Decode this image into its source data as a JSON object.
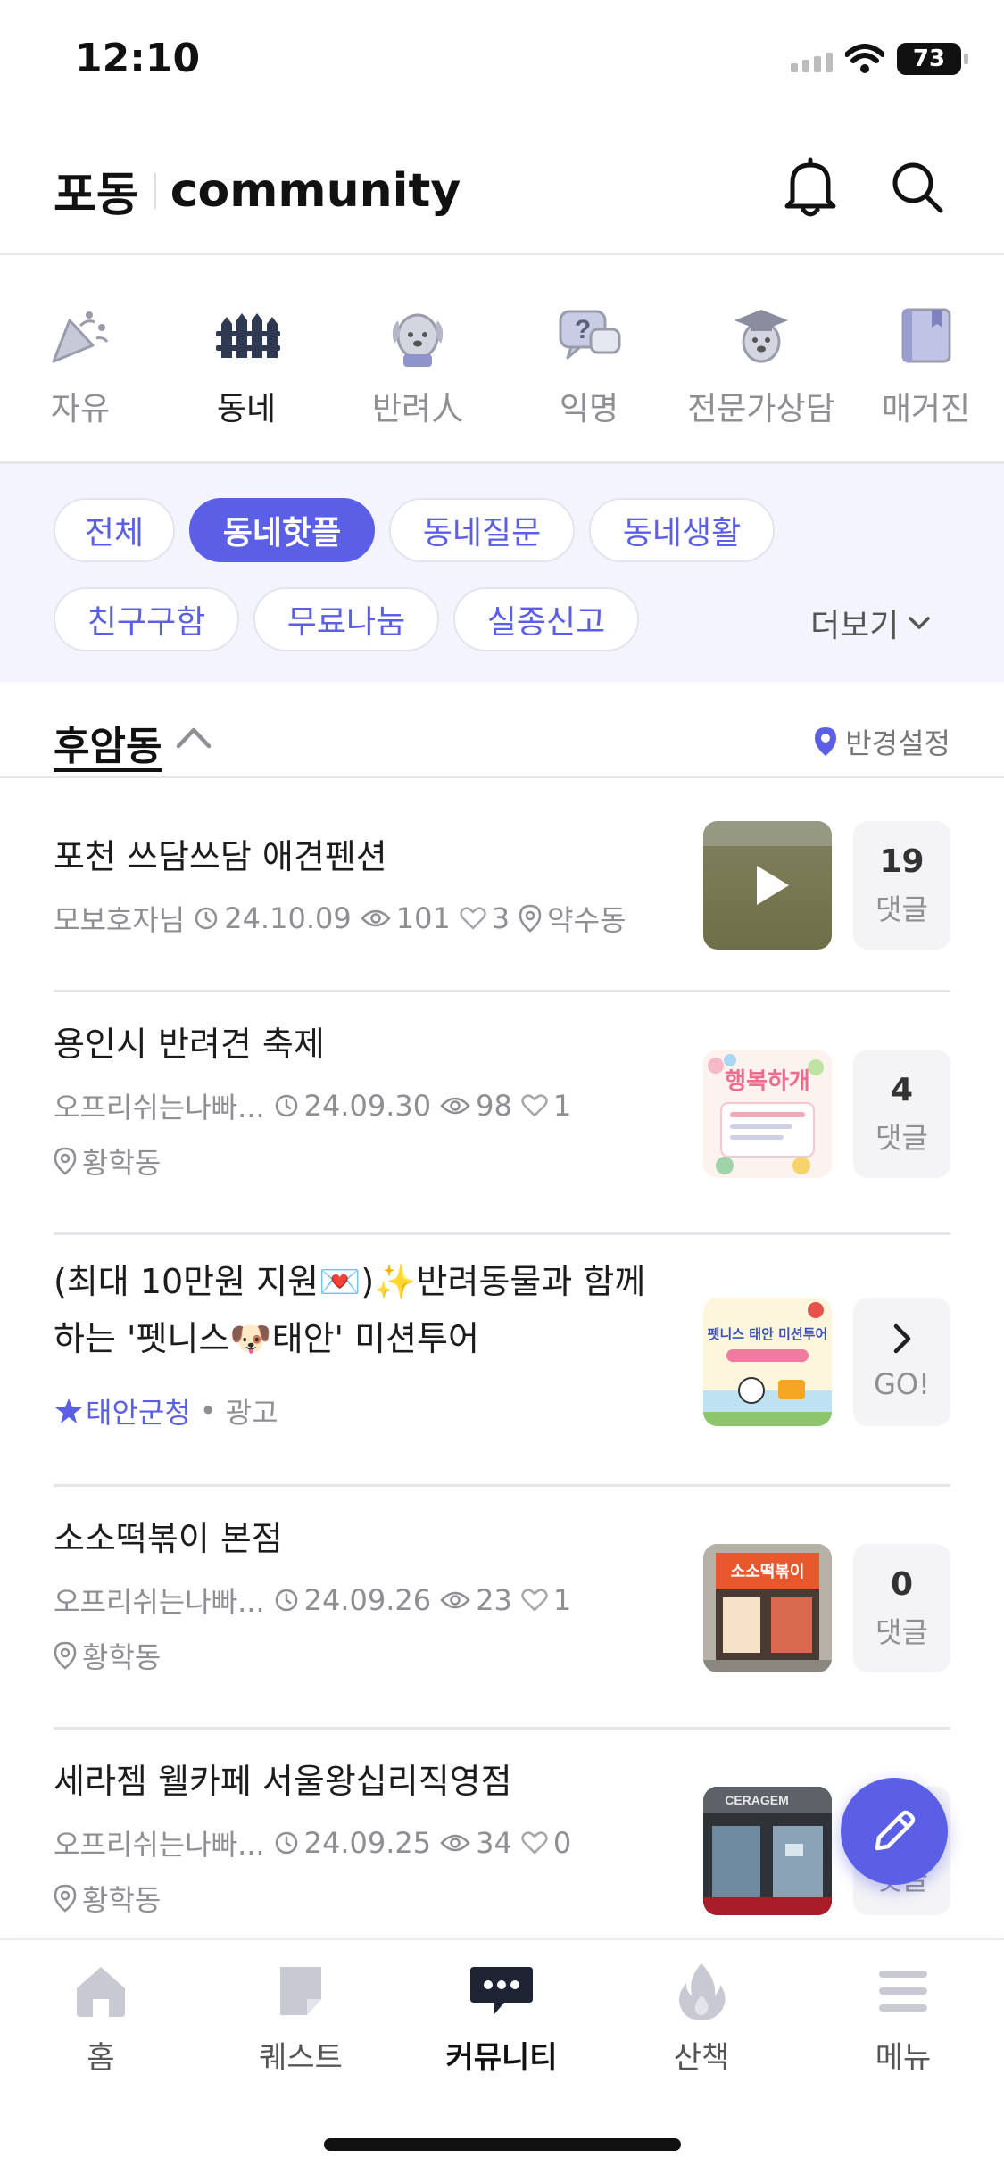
{
  "status_bar": {
    "time": "12:10",
    "battery": "73"
  },
  "header": {
    "logo_brand": "포동",
    "logo_community": "community"
  },
  "categories": [
    {
      "label": "자유",
      "icon": "party-popper-icon"
    },
    {
      "label": "동네",
      "icon": "fence-icon"
    },
    {
      "label": "반려人",
      "icon": "dog-face-icon"
    },
    {
      "label": "익명",
      "icon": "question-bubble-icon"
    },
    {
      "label": "전문가상담",
      "icon": "graduate-dog-icon"
    },
    {
      "label": "매거진",
      "icon": "magazine-icon"
    }
  ],
  "active_category": "동네",
  "filters": {
    "chips": [
      "전체",
      "동네핫플",
      "동네질문",
      "동네생활",
      "친구구함",
      "무료나눔",
      "실종신고"
    ],
    "active": "동네핫플",
    "more_label": "더보기"
  },
  "location": {
    "name": "후암동",
    "radius_label": "반경설정"
  },
  "posts": [
    {
      "title": "포천 쓰담쓰담 애견펜션",
      "author": "모보호자님",
      "date": "24.10.09",
      "views": "101",
      "likes": "3",
      "place": "약수동",
      "count": "19",
      "count_label": "댓글"
    },
    {
      "title": "용인시 반려견 축제",
      "author": "오프리쉬는나빠...",
      "date": "24.09.30",
      "views": "98",
      "likes": "1",
      "place": "황학동",
      "count": "4",
      "count_label": "댓글"
    },
    {
      "title_line1": "(최대 10만원 지원💌)✨반려동물과 함께",
      "title_line2": "하는 '펫니스🐶태안' 미션투어",
      "sponsor": "태안군청",
      "ad_label": "광고",
      "cta": "GO!"
    },
    {
      "title": "소소떡볶이 본점",
      "author": "오프리쉬는나빠...",
      "date": "24.09.26",
      "views": "23",
      "likes": "1",
      "place": "황학동",
      "count": "0",
      "count_label": "댓글"
    },
    {
      "title": "세라젬 웰카페 서울왕십리직영점",
      "author": "오프리쉬는나빠...",
      "date": "24.09.25",
      "views": "34",
      "likes": "0",
      "place": "황학동",
      "count_label": "댓글"
    }
  ],
  "thumb_texts": {
    "festival": "행복하개",
    "tour": "펫니스 태안 미션투어",
    "shop_sign": "소소떡볶이",
    "store_sign": "CERAGEM"
  },
  "bottom_nav": [
    {
      "label": "홈",
      "icon": "home-icon"
    },
    {
      "label": "퀘스트",
      "icon": "quest-note-icon"
    },
    {
      "label": "커뮤니티",
      "icon": "chat-bubble-icon"
    },
    {
      "label": "산책",
      "icon": "flame-icon"
    },
    {
      "label": "메뉴",
      "icon": "menu-icon"
    }
  ],
  "active_nav": "커뮤니티",
  "colors": {
    "accent": "#5b5fe6",
    "chip_bg": "#f3f4fd",
    "muted": "#8e8e93"
  }
}
